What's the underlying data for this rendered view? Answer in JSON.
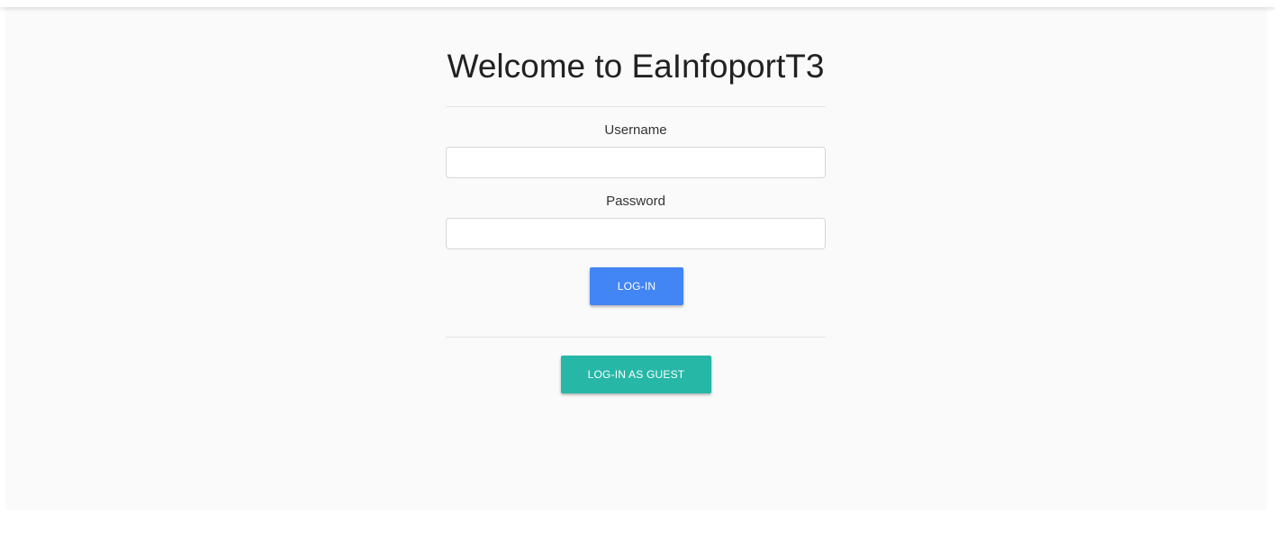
{
  "login": {
    "title": "Welcome to EaInfoportT3",
    "username_label": "Username",
    "username_value": "",
    "password_label": "Password",
    "password_value": "",
    "login_button": "LOG-IN",
    "guest_button": "LOG-IN AS GUEST"
  },
  "colors": {
    "background": "#fafafa",
    "login_button": "#4285f4",
    "guest_button": "#26b7a7",
    "text": "#212121"
  }
}
